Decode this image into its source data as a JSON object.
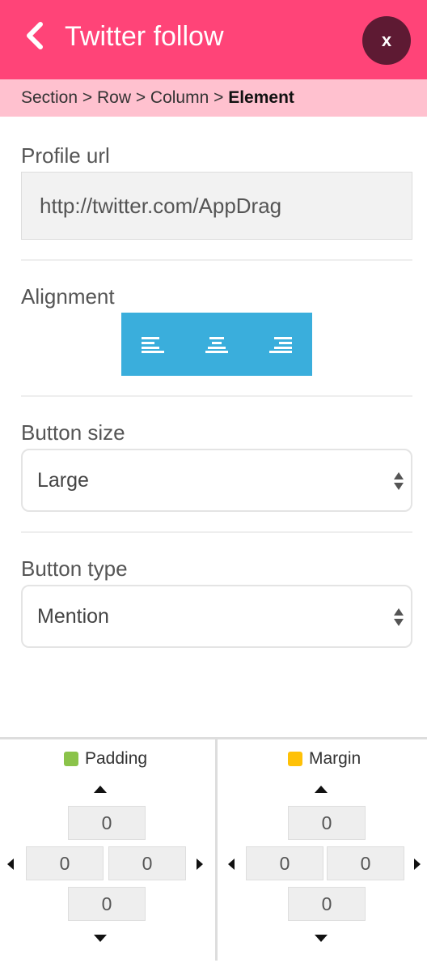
{
  "header": {
    "title": "Twitter follow",
    "close_label": "x",
    "background": "#ff4478",
    "close_bg": "#5e1a33"
  },
  "breadcrumb": {
    "path": "Section > Row > Column > ",
    "current": "Element"
  },
  "fields": {
    "profile_url": {
      "label": "Profile url",
      "value": "http://twitter.com/AppDrag"
    },
    "alignment": {
      "label": "Alignment",
      "options": [
        "left",
        "center",
        "right"
      ],
      "accent": "#3aaedc"
    },
    "button_size": {
      "label": "Button size",
      "value": "Large"
    },
    "button_type": {
      "label": "Button type",
      "value": "Mention"
    }
  },
  "spacing": {
    "padding": {
      "label": "Padding",
      "color": "#8bc34a",
      "top": "0",
      "left": "0",
      "right": "0",
      "bottom": "0"
    },
    "margin": {
      "label": "Margin",
      "color": "#ffc107",
      "top": "0",
      "left": "0",
      "right": "0",
      "bottom": "0"
    }
  }
}
